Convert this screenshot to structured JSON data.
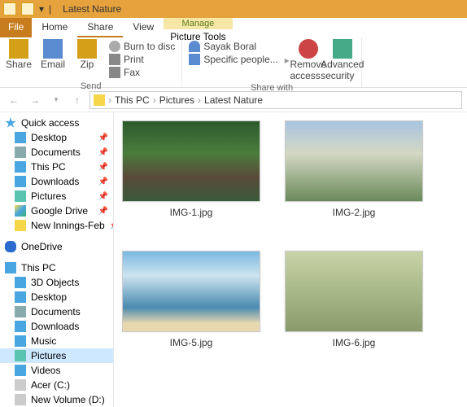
{
  "window": {
    "title": "Latest Nature"
  },
  "tabs": {
    "file": "File",
    "home": "Home",
    "share": "Share",
    "view": "View",
    "contextGroup": "Manage",
    "contextTab": "Picture Tools"
  },
  "ribbon": {
    "share": "Share",
    "email": "Email",
    "zip": "Zip",
    "burn": "Burn to disc",
    "print": "Print",
    "fax": "Fax",
    "sendGroup": "Send",
    "sayak": "Sayak Boral",
    "specific": "Specific people...",
    "remove": "Remove access",
    "advanced": "Advanced security",
    "shareGroup": "Share with"
  },
  "breadcrumb": {
    "pc": "This PC",
    "p1": "Pictures",
    "p2": "Latest Nature"
  },
  "side": {
    "quick": "Quick access",
    "qitems": [
      {
        "label": "Desktop",
        "icon": "ic-desktop",
        "pin": true
      },
      {
        "label": "Documents",
        "icon": "ic-doc",
        "pin": true
      },
      {
        "label": "This PC",
        "icon": "ic-pc",
        "pin": true
      },
      {
        "label": "Downloads",
        "icon": "ic-down",
        "pin": true
      },
      {
        "label": "Pictures",
        "icon": "ic-pic",
        "pin": true
      },
      {
        "label": "Google Drive",
        "icon": "ic-gdrive",
        "pin": true
      },
      {
        "label": "New Innings-Feb",
        "icon": "ic-folder",
        "pin": true
      }
    ],
    "onedrive": "OneDrive",
    "thispc": "This PC",
    "pcitems": [
      {
        "label": "3D Objects",
        "icon": "ic-3d"
      },
      {
        "label": "Desktop",
        "icon": "ic-desktop"
      },
      {
        "label": "Documents",
        "icon": "ic-doc"
      },
      {
        "label": "Downloads",
        "icon": "ic-down"
      },
      {
        "label": "Music",
        "icon": "ic-music"
      },
      {
        "label": "Pictures",
        "icon": "ic-pic",
        "sel": true
      },
      {
        "label": "Videos",
        "icon": "ic-video"
      },
      {
        "label": "Acer (C:)",
        "icon": "ic-drive"
      },
      {
        "label": "New Volume (D:)",
        "icon": "ic-drive"
      }
    ]
  },
  "thumbs": [
    {
      "name": "IMG-1.jpg",
      "cls": "forest"
    },
    {
      "name": "IMG-2.jpg",
      "cls": "mountain"
    },
    {
      "name": "IMG-5.jpg",
      "cls": "beach"
    },
    {
      "name": "IMG-6.jpg",
      "cls": "tree"
    }
  ]
}
